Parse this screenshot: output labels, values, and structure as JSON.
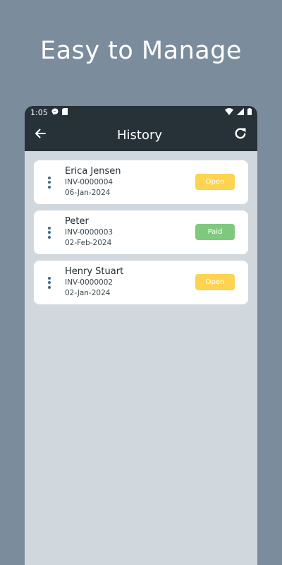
{
  "promo": {
    "title": "Easy to Manage"
  },
  "status_bar": {
    "time": "1:05"
  },
  "app_bar": {
    "title": "History"
  },
  "invoices": [
    {
      "name": "Erica Jensen",
      "number": "INV-0000004",
      "date": "06-Jan-2024",
      "status": "Open",
      "status_color": "#fdd34f"
    },
    {
      "name": "Peter",
      "number": "INV-0000003",
      "date": "02-Feb-2024",
      "status": "Paid",
      "status_color": "#7fc97f"
    },
    {
      "name": "Henry Stuart",
      "number": "INV-0000002",
      "date": "02-Jan-2024",
      "status": "Open",
      "status_color": "#fdd34f"
    }
  ],
  "colors": {
    "background": "#7b8d9c",
    "app_bar": "#263238",
    "screen": "#d0d8de",
    "kebab": "#3d6b87"
  }
}
